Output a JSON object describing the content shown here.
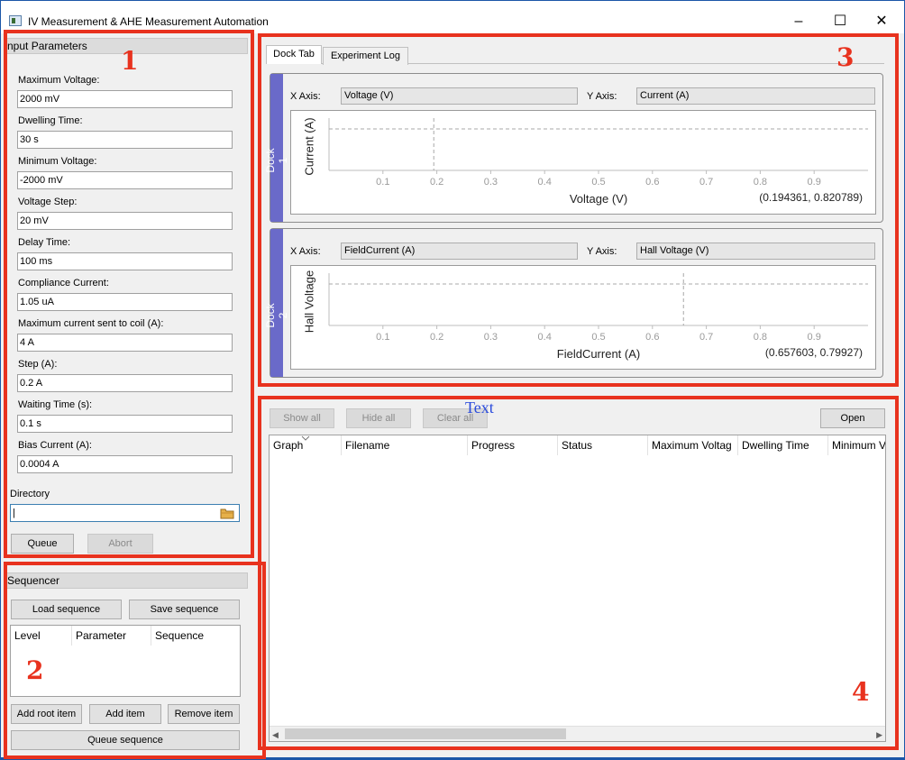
{
  "window": {
    "title": "IV Measurement & AHE Measurement Automation"
  },
  "annotations": {
    "box1": "1",
    "box2": "2",
    "box3": "3",
    "box4": "4",
    "text": "Text"
  },
  "input_parameters": {
    "title": "nput Parameters",
    "fields": [
      {
        "label": "Maximum Voltage:",
        "value": "2000 mV"
      },
      {
        "label": "Dwelling Time:",
        "value": "30 s"
      },
      {
        "label": "Minimum Voltage:",
        "value": "-2000 mV"
      },
      {
        "label": "Voltage Step:",
        "value": "20 mV"
      },
      {
        "label": "Delay Time:",
        "value": "100 ms"
      },
      {
        "label": "Compliance Current:",
        "value": "1.05 uA"
      },
      {
        "label": "Maximum current sent to coil (A):",
        "value": "4 A"
      },
      {
        "label": "Step (A):",
        "value": "0.2 A"
      },
      {
        "label": "Waiting Time (s):",
        "value": "0.1 s"
      },
      {
        "label": "Bias Current (A):",
        "value": "0.0004 A"
      }
    ],
    "directory_label": "Directory",
    "directory_value": "|",
    "queue_label": "Queue",
    "abort_label": "Abort"
  },
  "sequencer": {
    "title": "Sequencer",
    "load_label": "Load sequence",
    "save_label": "Save sequence",
    "columns": [
      "Level",
      "Parameter",
      "Sequence"
    ],
    "add_root_label": "Add root item",
    "add_item_label": "Add item",
    "remove_item_label": "Remove item",
    "queue_sequence_label": "Queue sequence"
  },
  "tabs": [
    {
      "label": "Dock Tab",
      "active": true
    },
    {
      "label": "Experiment Log",
      "active": false
    }
  ],
  "docks": [
    {
      "name": "Dock 1",
      "x_axis_label": "X Axis:",
      "x_axis_value": "Voltage (V)",
      "y_axis_label": "Y Axis:",
      "y_axis_value": "Current (A)",
      "plot_ylabel": "Current (A)",
      "plot_xlabel": "Voltage (V)",
      "coords": "(0.194361, 0.820789)",
      "cursor_x": 0.194361,
      "cursor_y": 0.820789
    },
    {
      "name": "Dock 2",
      "x_axis_label": "X Axis:",
      "x_axis_value": "FieldCurrent (A)",
      "y_axis_label": "Y Axis:",
      "y_axis_value": "Hall Voltage (V)",
      "plot_ylabel": "Hall Voltage",
      "plot_xlabel": "FieldCurrent (A)",
      "coords": "(0.657603, 0.79927)",
      "cursor_x": 0.657603,
      "cursor_y": 0.79927
    }
  ],
  "plot_ticks": [
    "0.1",
    "0.2",
    "0.3",
    "0.4",
    "0.5",
    "0.6",
    "0.7",
    "0.8",
    "0.9"
  ],
  "queue_panel": {
    "show_all_label": "Show all",
    "hide_all_label": "Hide all",
    "clear_all_label": "Clear all",
    "open_label": "Open",
    "columns": [
      "Graph",
      "Filename",
      "Progress",
      "Status",
      "Maximum Voltag",
      "Dwelling Time",
      "Minimum V"
    ]
  },
  "colors": {
    "annotation_red": "#e8321e",
    "dock_strip": "#6a6ac9",
    "annotation_blue": "#2a4bdc"
  }
}
